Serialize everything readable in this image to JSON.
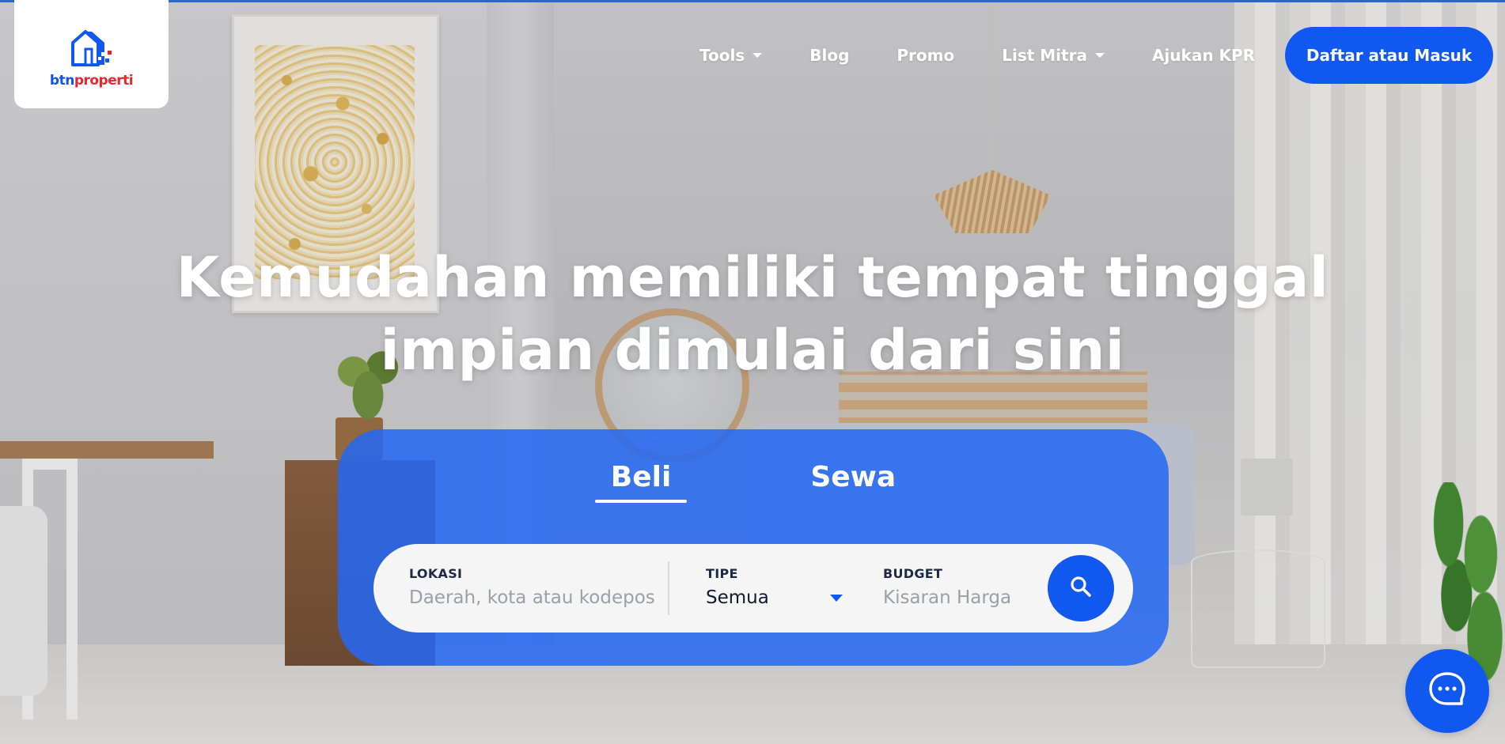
{
  "brand": {
    "logo_text_part1": "btn",
    "logo_text_part2": "properti",
    "accent_color": "#1158f0",
    "logo_red": "#e8262f"
  },
  "header": {
    "nav": [
      {
        "label": "Tools",
        "has_dropdown": true
      },
      {
        "label": "Blog",
        "has_dropdown": false
      },
      {
        "label": "Promo",
        "has_dropdown": false
      },
      {
        "label": "List Mitra",
        "has_dropdown": true
      },
      {
        "label": "Ajukan KPR",
        "has_dropdown": false
      }
    ],
    "login_button": "Daftar atau Masuk"
  },
  "hero": {
    "title_line1": "Kemudahan memiliki tempat tinggal",
    "title_line2": "impian dimulai dari sini"
  },
  "search": {
    "tabs": [
      {
        "label": "Beli",
        "active": true
      },
      {
        "label": "Sewa",
        "active": false
      }
    ],
    "lokasi": {
      "label": "LOKASI",
      "placeholder": "Daerah, kota atau kodepos"
    },
    "tipe": {
      "label": "TIPE",
      "value": "Semua"
    },
    "budget": {
      "label": "BUDGET",
      "placeholder": "Kisaran Harga"
    },
    "search_icon": "search-icon"
  },
  "chat": {
    "icon": "chat-bubble-icon"
  }
}
